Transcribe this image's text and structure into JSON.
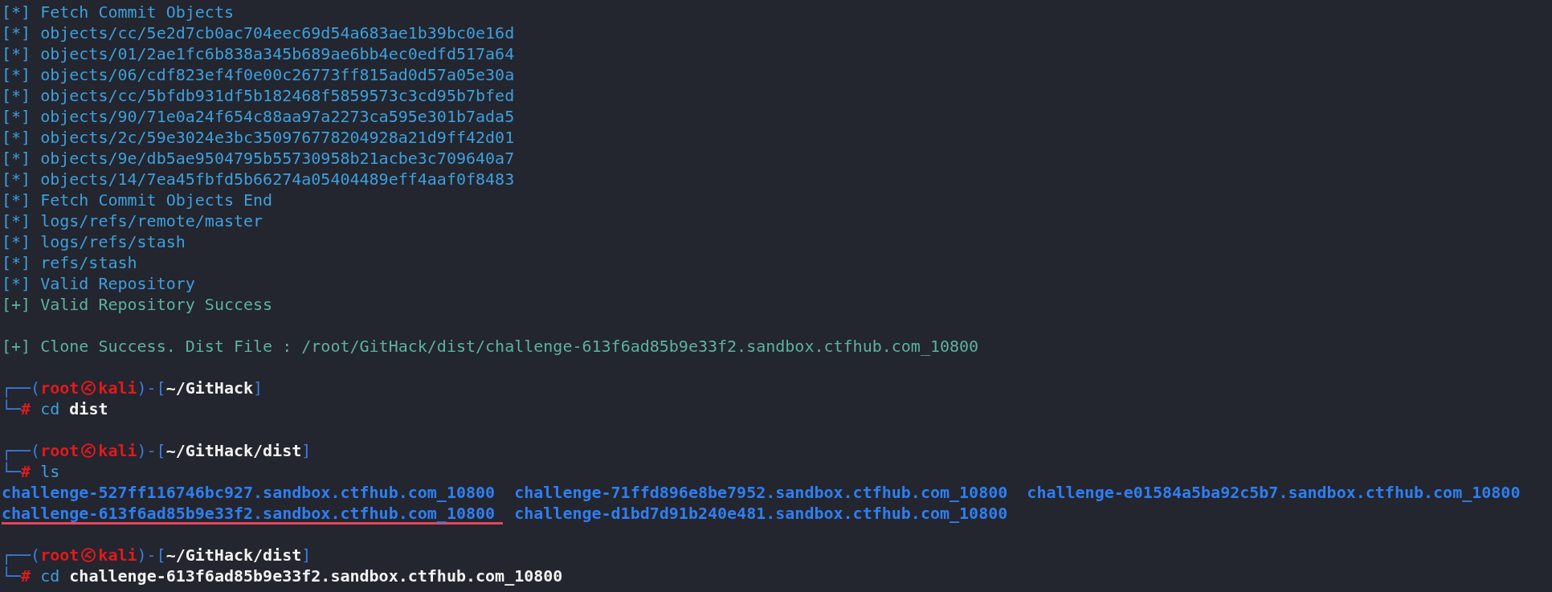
{
  "lines": [
    {
      "kind": "info",
      "text": "[*] Fetch Commit Objects"
    },
    {
      "kind": "info",
      "text": "[*] objects/cc/5e2d7cb0ac704eec69d54a683ae1b39bc0e16d"
    },
    {
      "kind": "info",
      "text": "[*] objects/01/2ae1fc6b838a345b689ae6bb4ec0edfd517a64"
    },
    {
      "kind": "info",
      "text": "[*] objects/06/cdf823ef4f0e00c26773ff815ad0d57a05e30a"
    },
    {
      "kind": "info",
      "text": "[*] objects/cc/5bfdb931df5b182468f5859573c3cd95b7bfed"
    },
    {
      "kind": "info",
      "text": "[*] objects/90/71e0a24f654c88aa97a2273ca595e301b7ada5"
    },
    {
      "kind": "info",
      "text": "[*] objects/2c/59e3024e3bc350976778204928a21d9ff42d01"
    },
    {
      "kind": "info",
      "text": "[*] objects/9e/db5ae9504795b55730958b21acbe3c709640a7"
    },
    {
      "kind": "info",
      "text": "[*] objects/14/7ea45fbfd5b66274a05404489eff4aaf0f8483"
    },
    {
      "kind": "info",
      "text": "[*] Fetch Commit Objects End"
    },
    {
      "kind": "info",
      "text": "[*] logs/refs/remote/master"
    },
    {
      "kind": "info",
      "text": "[*] logs/refs/stash"
    },
    {
      "kind": "info",
      "text": "[*] refs/stash"
    },
    {
      "kind": "info",
      "text": "[*] Valid Repository"
    },
    {
      "kind": "success",
      "text": "[+] Valid Repository Success"
    },
    {
      "kind": "blank"
    },
    {
      "kind": "success",
      "text": "[+] Clone Success. Dist File : /root/GitHack/dist/challenge-613f6ad85b9e33f2.sandbox.ctfhub.com_10800"
    },
    {
      "kind": "blank"
    },
    {
      "kind": "prompt",
      "open": "┌──(",
      "user": "root",
      "host": "kali",
      "mid": ")-[",
      "path": "~/GitHack",
      "close": "]",
      "corner": "└─",
      "hash": "#",
      "command": "cd",
      "argument": "dist"
    },
    {
      "kind": "blank"
    },
    {
      "kind": "prompt",
      "open": "┌──(",
      "user": "root",
      "host": "kali",
      "mid": ")-[",
      "path": "~/GitHack/dist",
      "close": "]",
      "corner": "└─",
      "hash": "#",
      "command": "ls"
    },
    {
      "kind": "listing",
      "rows": [
        [
          {
            "name": "challenge-527ff116746bc927.sandbox.ctfhub.com_10800",
            "underlined": false
          },
          {
            "name": "challenge-71ffd896e8be7952.sandbox.ctfhub.com_10800",
            "underlined": false
          },
          {
            "name": "challenge-e01584a5ba92c5b7.sandbox.ctfhub.com_10800",
            "underlined": false
          }
        ],
        [
          {
            "name": "challenge-613f6ad85b9e33f2.sandbox.ctfhub.com_10800",
            "underlined": true
          },
          {
            "name": "challenge-d1bd7d91b240e481.sandbox.ctfhub.com_10800",
            "underlined": false
          }
        ]
      ]
    },
    {
      "kind": "blank"
    },
    {
      "kind": "prompt",
      "open": "┌──(",
      "user": "root",
      "host": "kali",
      "mid": ")-[",
      "path": "~/GitHack/dist",
      "close": "]",
      "corner": "└─",
      "hash": "#",
      "command": "cd",
      "argument": "challenge-613f6ad85b9e33f2.sandbox.ctfhub.com_10800"
    }
  ]
}
